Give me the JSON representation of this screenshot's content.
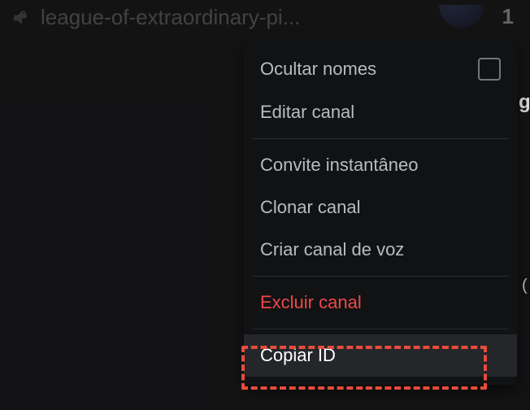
{
  "channel": {
    "name": "league-of-extraordinary-pi..."
  },
  "topRight": {
    "count": "1"
  },
  "contextMenu": {
    "hideNames": "Ocultar nomes",
    "editChannel": "Editar canal",
    "instantInvite": "Convite instantâneo",
    "cloneChannel": "Clonar canal",
    "createVoiceChannel": "Criar canal de voz",
    "deleteChannel": "Excluir canal",
    "copyId": "Copiar ID"
  },
  "fragments": {
    "g": "g",
    "paren": "("
  }
}
